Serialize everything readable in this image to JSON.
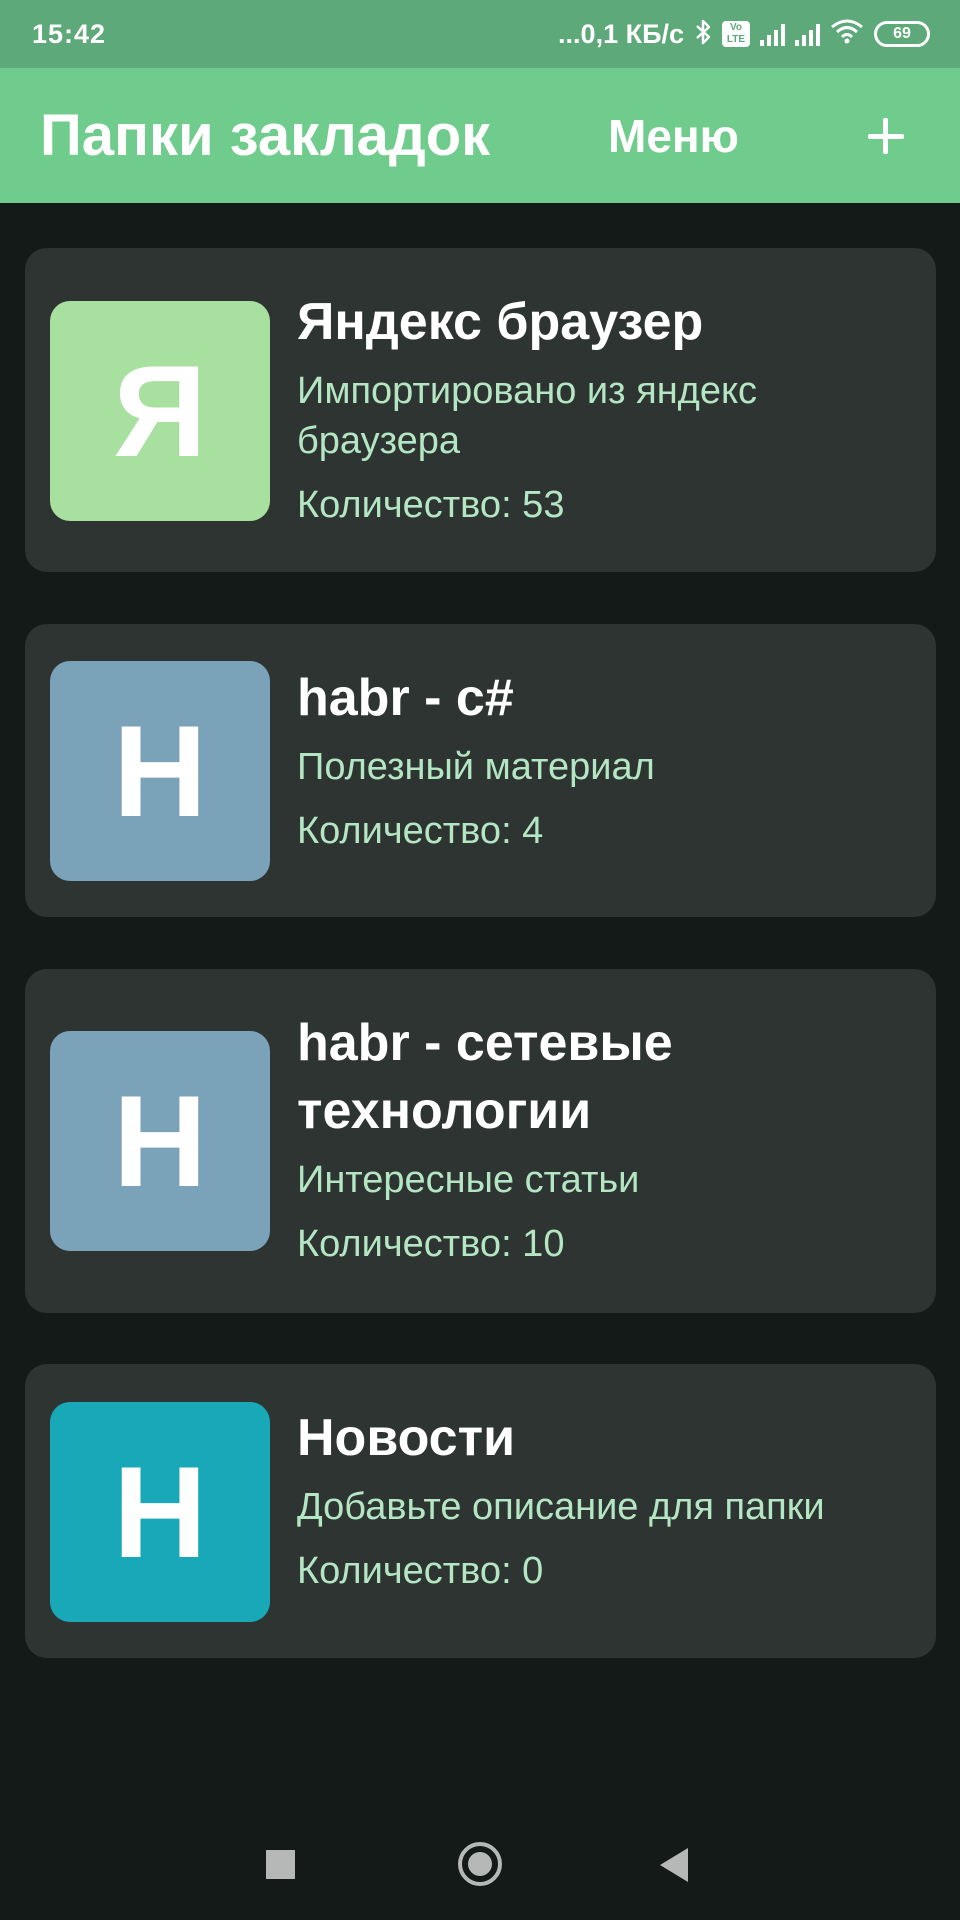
{
  "status_bar": {
    "time": "15:42",
    "network_speed": "...0,1 КБ/с",
    "bluetooth_icon": "bluetooth-icon",
    "volte_label": "Vo LTE",
    "battery_level": "69"
  },
  "app_bar": {
    "title": "Папки закладок",
    "menu_label": "Меню",
    "add_icon": "plus-icon"
  },
  "folders": [
    {
      "letter": "Я",
      "color": "#a8e0a0",
      "title": "Яндекс браузер",
      "description": "Импортировано из яндекс браузера",
      "count": "Количество: 53"
    },
    {
      "letter": "H",
      "color": "#7aa2b8",
      "title": "habr - c#",
      "description": "Полезный материал",
      "count": "Количество: 4"
    },
    {
      "letter": "H",
      "color": "#7aa2b8",
      "title": "habr - сетевые технологии",
      "description": "Интересные статьи",
      "count": "Количество: 10"
    },
    {
      "letter": "H",
      "color": "#19a8b8",
      "title": "Новости",
      "description": "Добавьте описание для папки",
      "count": "Количество: 0"
    }
  ],
  "nav_bar": {
    "recents_icon": "square-icon",
    "home_icon": "circle-icon",
    "back_icon": "triangle-back-icon"
  },
  "colors": {
    "status_bar": "#5ea97a",
    "app_bar": "#70cc8c",
    "background": "#141a17",
    "card": "#2e3431",
    "secondary_text": "#b4e6c4"
  }
}
